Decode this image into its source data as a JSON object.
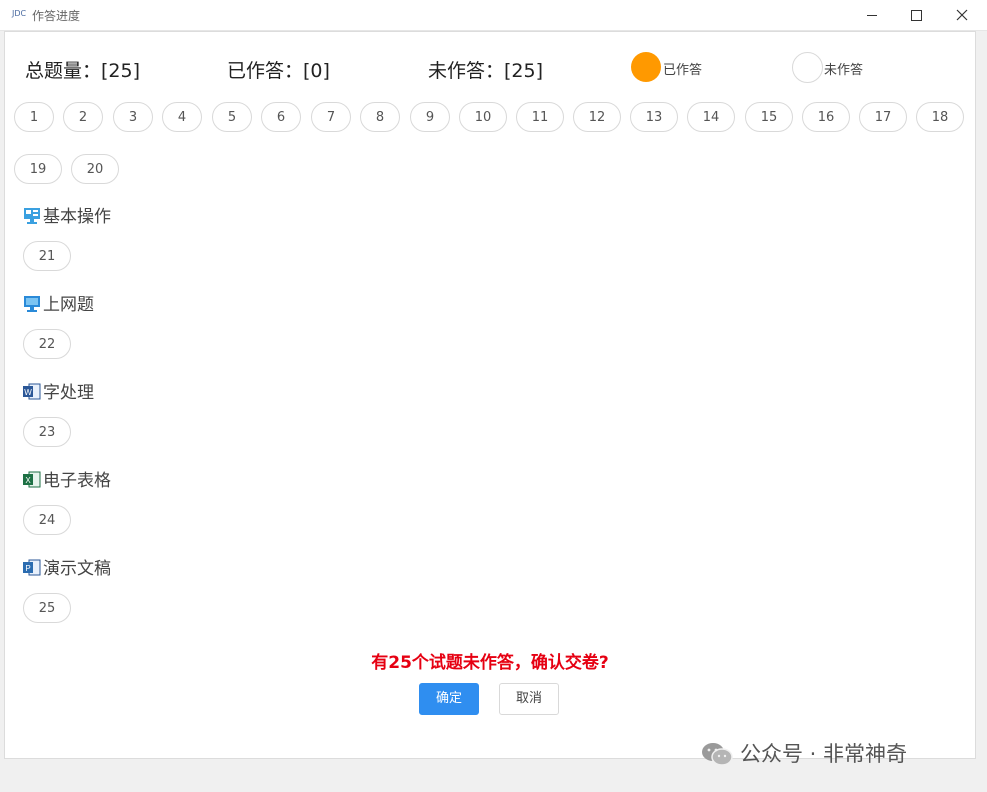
{
  "window": {
    "title": "作答进度",
    "app_icon_text": "JDC"
  },
  "summary": {
    "total": "总题量：[25]",
    "answered": "已作答：[0]",
    "unanswered": "未作答：[25]"
  },
  "legend": {
    "answered_label": "已作答",
    "answered_color": "#ff9900",
    "unanswered_label": "未作答"
  },
  "questions": [
    "1",
    "2",
    "3",
    "4",
    "5",
    "6",
    "7",
    "8",
    "9",
    "10",
    "11",
    "12",
    "13",
    "14",
    "15",
    "16",
    "17",
    "18",
    "19",
    "20"
  ],
  "sections": [
    {
      "title": "基本操作",
      "icon": "computer-settings-icon",
      "question": "21"
    },
    {
      "title": "上网题",
      "icon": "monitor-icon",
      "question": "22"
    },
    {
      "title": "字处理",
      "icon": "word-icon",
      "question": "23"
    },
    {
      "title": "电子表格",
      "icon": "excel-icon",
      "question": "24"
    },
    {
      "title": "演示文稿",
      "icon": "powerpoint-icon",
      "question": "25"
    }
  ],
  "confirm": {
    "message": "有25个试题未作答，确认交卷?",
    "ok_label": "确定",
    "cancel_label": "取消",
    "message_color": "#e60012",
    "ok_color": "#2f8ef0"
  },
  "watermark": "公众号 · 非常神奇"
}
